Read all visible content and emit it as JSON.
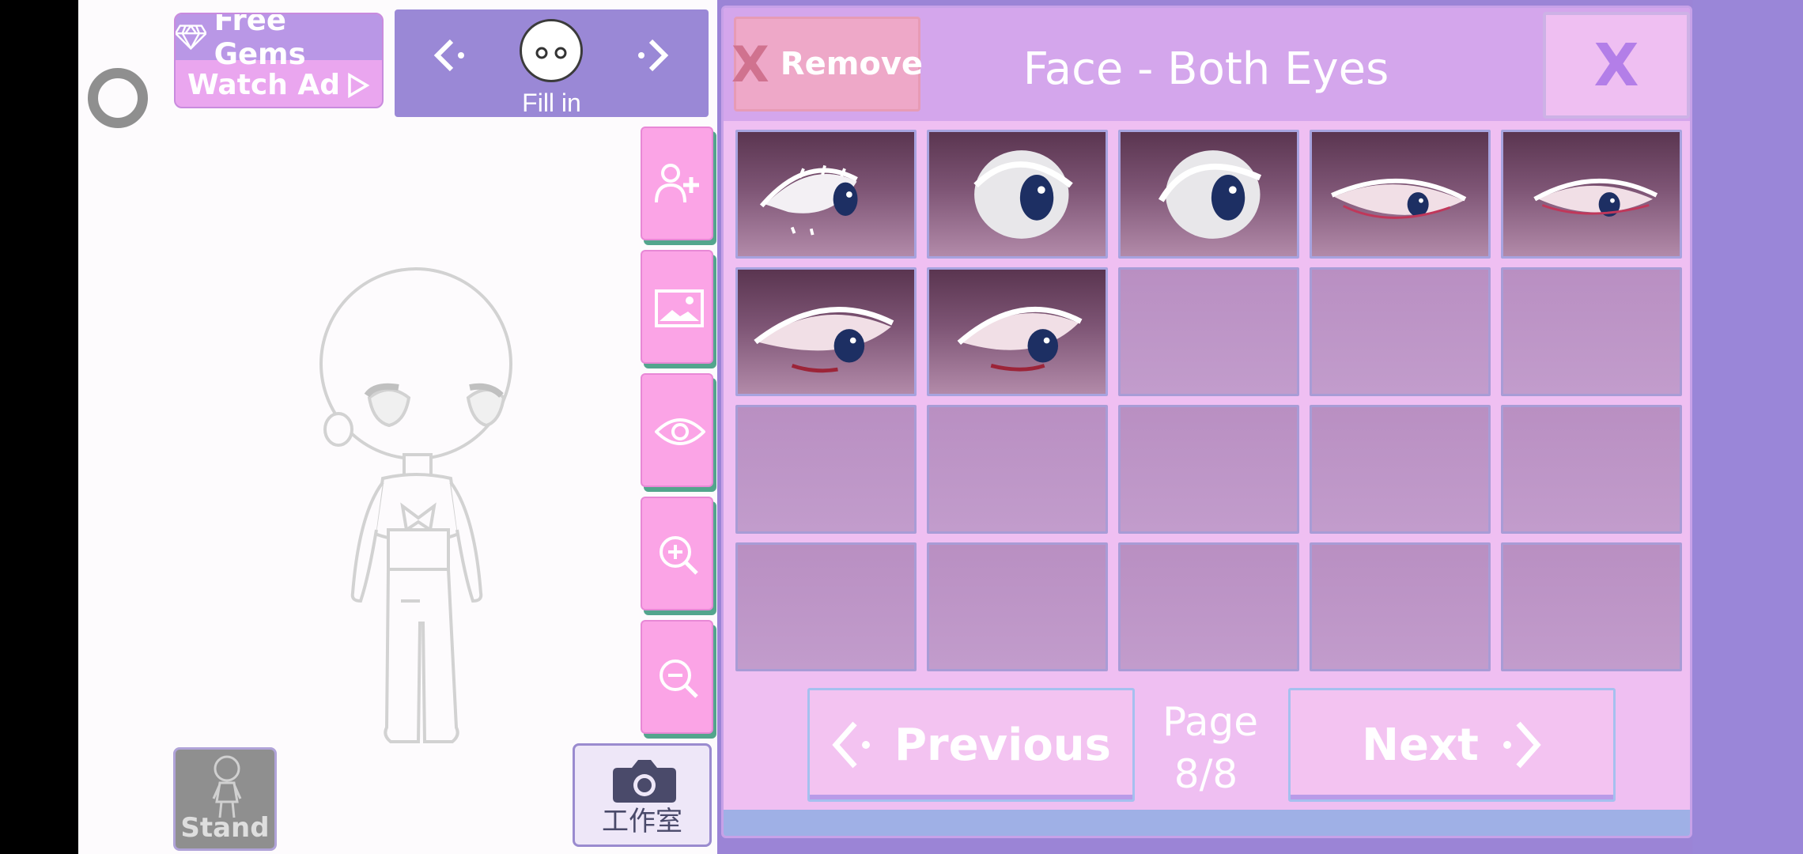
{
  "top_bar": {
    "free_gems_label": "Free Gems",
    "watch_ad_label": "Watch Ad"
  },
  "chooser": {
    "prev_glyph": "<·",
    "next_glyph": "·>",
    "mode_label": "Fill in"
  },
  "side_tools": [
    {
      "icon": "add-person-icon"
    },
    {
      "icon": "background-image-icon"
    },
    {
      "icon": "eye-icon"
    },
    {
      "icon": "zoom-in-icon"
    },
    {
      "icon": "zoom-out-icon"
    }
  ],
  "bottom": {
    "stand_label": "Stand",
    "studio_label": "工作室"
  },
  "dialog": {
    "remove_x": "X",
    "remove_label": "Remove",
    "title": "Face - Both Eyes",
    "close_label": "X",
    "previous_label": "Previous",
    "next_label": "Next",
    "page_label": "Page",
    "page_value": "8/8",
    "filled_slots": 7,
    "total_slots": 20
  },
  "colors": {
    "panel": "#9b84d6",
    "dialog_bg": "#efbff2",
    "header": "#d4a6ec",
    "remove_button": "#eea8c8",
    "side_button": "#fba4e6",
    "iris": "#1d2f63"
  }
}
